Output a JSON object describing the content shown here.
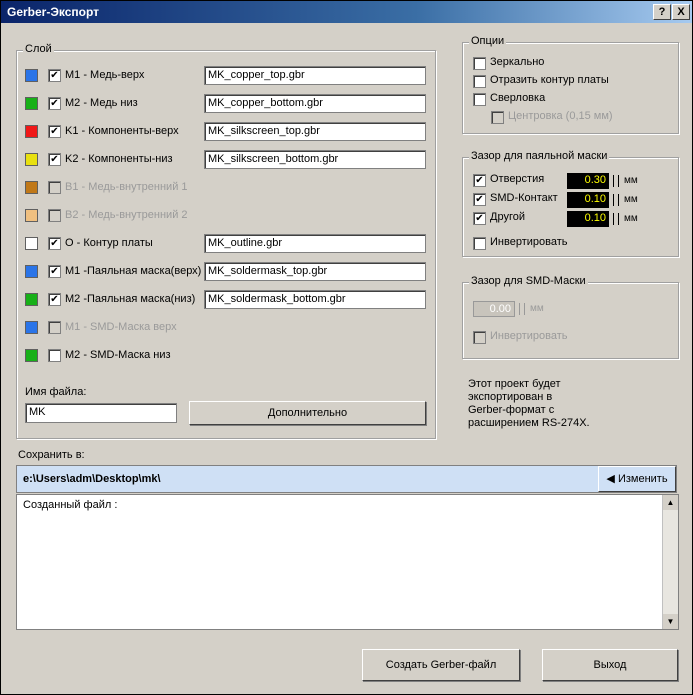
{
  "window": {
    "title": "Gerber-Экспорт",
    "help_label": "?",
    "close_label": "X"
  },
  "layers": {
    "group_label": "Слой",
    "items": [
      {
        "label": "M1 - Медь-верх",
        "color": "#2a74e8",
        "checked": "✔",
        "file": "MK_copper_top.gbr",
        "enabled": true
      },
      {
        "label": "M2 - Медь низ",
        "color": "#18b018",
        "checked": "✔",
        "file": "MK_copper_bottom.gbr",
        "enabled": true
      },
      {
        "label": "K1 - Компоненты-верх",
        "color": "#f01818",
        "checked": "✔",
        "file": "MK_silkscreen_top.gbr",
        "enabled": true
      },
      {
        "label": "K2 - Компоненты-низ",
        "color": "#e8e010",
        "checked": "✔",
        "file": "MK_silkscreen_bottom.gbr",
        "enabled": true
      },
      {
        "label": "B1 - Медь-внутренний 1",
        "color": "#c07818",
        "checked": "",
        "file": "",
        "enabled": false
      },
      {
        "label": "B2 - Медь-внутренний 2",
        "color": "#f0c080",
        "checked": "",
        "file": "",
        "enabled": false
      },
      {
        "label": "O - Контур платы",
        "color": "#ffffff",
        "checked": "✔",
        "file": "MK_outline.gbr",
        "enabled": true
      },
      {
        "label": "M1 -Паяльная маска(верх)",
        "color": "#2a74e8",
        "checked": "✔",
        "file": "MK_soldermask_top.gbr",
        "enabled": true
      },
      {
        "label": "M2 -Паяльная маска(низ)",
        "color": "#18b018",
        "checked": "✔",
        "file": "MK_soldermask_bottom.gbr",
        "enabled": true
      },
      {
        "label": "M1 - SMD-Маска верх",
        "color": "#2a74e8",
        "checked": "",
        "file": "",
        "enabled": false
      },
      {
        "label": "M2 - SMD-Маска низ",
        "color": "#18b018",
        "checked": "",
        "file": "",
        "enabled": true
      }
    ],
    "filename_label": "Имя файла:",
    "filename_value": "MK",
    "advanced_button": "Дополнительно"
  },
  "options": {
    "group_label": "Опции",
    "mirror": {
      "label": "Зеркально",
      "checked": ""
    },
    "mirror_outline": {
      "label": "Отразить контур платы",
      "checked": ""
    },
    "drilling": {
      "label": "Сверловка",
      "checked": ""
    },
    "centering": {
      "label": "Центровка (0,15 мм)",
      "checked": ""
    }
  },
  "solder_mask": {
    "group_label": "Зазор для паяльной маски",
    "rows": [
      {
        "label": "Отверстия",
        "checked": "✔",
        "value": "0.30",
        "unit": "мм"
      },
      {
        "label": "SMD-Контакт",
        "checked": "✔",
        "value": "0.10",
        "unit": "мм"
      },
      {
        "label": "Другой",
        "checked": "✔",
        "value": "0.10",
        "unit": "мм"
      }
    ],
    "invert": {
      "label": "Инвертировать",
      "checked": ""
    }
  },
  "smd_mask": {
    "group_label": "Зазор для SMD-Маски",
    "value": "0.00",
    "unit": "мм",
    "invert": {
      "label": "Инвертировать",
      "checked": ""
    }
  },
  "info_text": [
    "Этот проект будет",
    "экспортирован в",
    "Gerber-формат с",
    "расширением RS-274X."
  ],
  "save": {
    "label": "Сохранить в:",
    "path": "e:\\Users\\adm\\Desktop\\mk\\",
    "change_button": "Изменить",
    "change_icon": "arrow-left-icon"
  },
  "log": {
    "text": "Созданный файл  :"
  },
  "buttons": {
    "create": "Создать Gerber-файл",
    "exit": "Выход"
  }
}
